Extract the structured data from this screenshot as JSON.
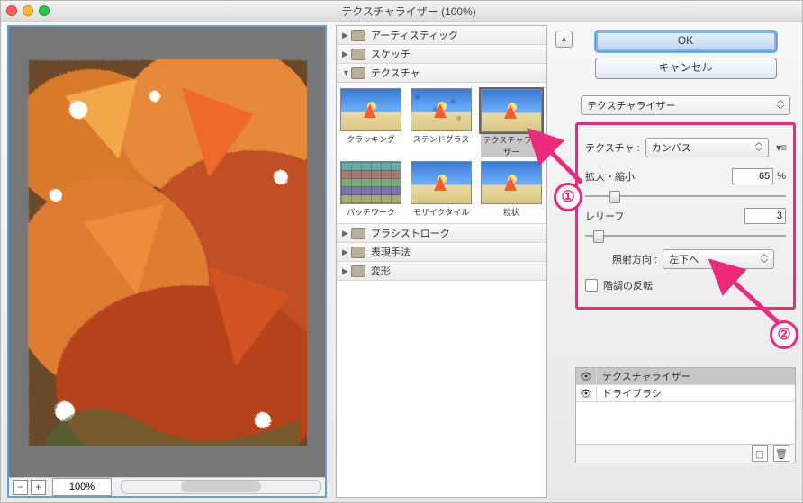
{
  "window": {
    "title": "テクスチャライザー (100%)"
  },
  "preview": {
    "zoom": "100%"
  },
  "categories": [
    {
      "label": "アーティスティック",
      "open": false
    },
    {
      "label": "スケッチ",
      "open": false
    },
    {
      "label": "テクスチャ",
      "open": true
    },
    {
      "label": "ブラシストローク",
      "open": false
    },
    {
      "label": "表現手法",
      "open": false
    },
    {
      "label": "変形",
      "open": false
    }
  ],
  "texture_filters": [
    {
      "label": "クラッキング"
    },
    {
      "label": "ステンドグラス"
    },
    {
      "label": "テクスチャライザー",
      "selected": true
    },
    {
      "label": "パッチワーク"
    },
    {
      "label": "モザイクタイル"
    },
    {
      "label": "粒状"
    }
  ],
  "buttons": {
    "ok": "OK",
    "cancel": "キャンセル"
  },
  "filter_select": "テクスチャライザー",
  "params": {
    "texture_label": "テクスチャ :",
    "texture_value": "カンバス",
    "scale_label": "拡大・縮小",
    "scale_value": "65",
    "scale_unit": "%",
    "relief_label": "レリーフ",
    "relief_value": "3",
    "light_label": "照射方向 :",
    "light_value": "左下へ",
    "invert_label": "階調の反転"
  },
  "layers": [
    {
      "name": "テクスチャライザー",
      "selected": true,
      "visible": true
    },
    {
      "name": "ドライブラシ",
      "selected": false,
      "visible": true
    }
  ],
  "badges": {
    "one": "①",
    "two": "②"
  }
}
